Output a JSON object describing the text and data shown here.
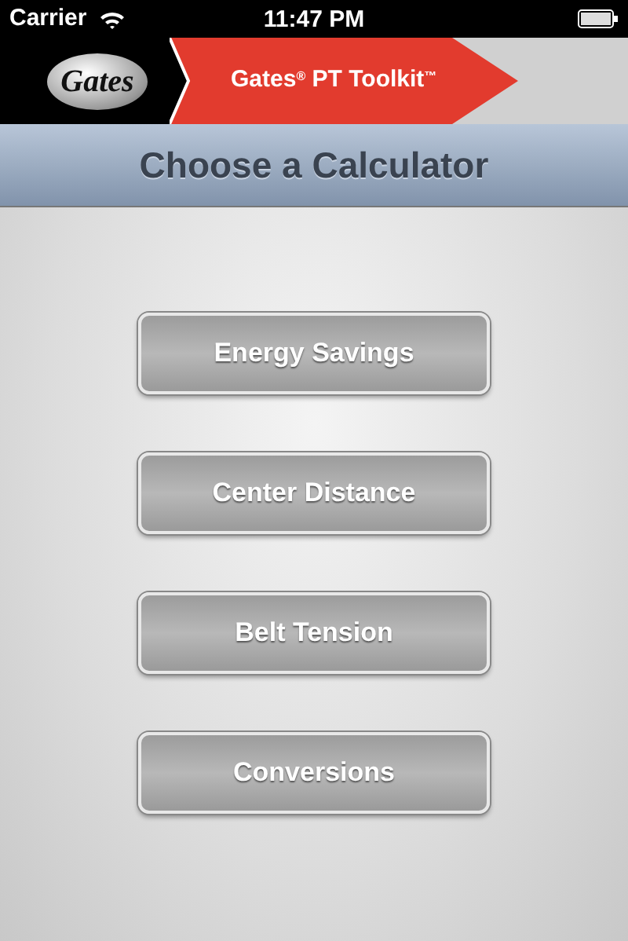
{
  "status_bar": {
    "carrier": "Carrier",
    "time": "11:47 PM"
  },
  "header": {
    "logo_text": "Gates",
    "title": "Gates$^{®}$ PT Toolkit$^{™}$"
  },
  "subheader": {
    "title": "Choose a Calculator"
  },
  "buttons": [
    {
      "label": "Energy Savings"
    },
    {
      "label": "Center Distance"
    },
    {
      "label": "Belt Tension"
    },
    {
      "label": "Conversions"
    }
  ]
}
